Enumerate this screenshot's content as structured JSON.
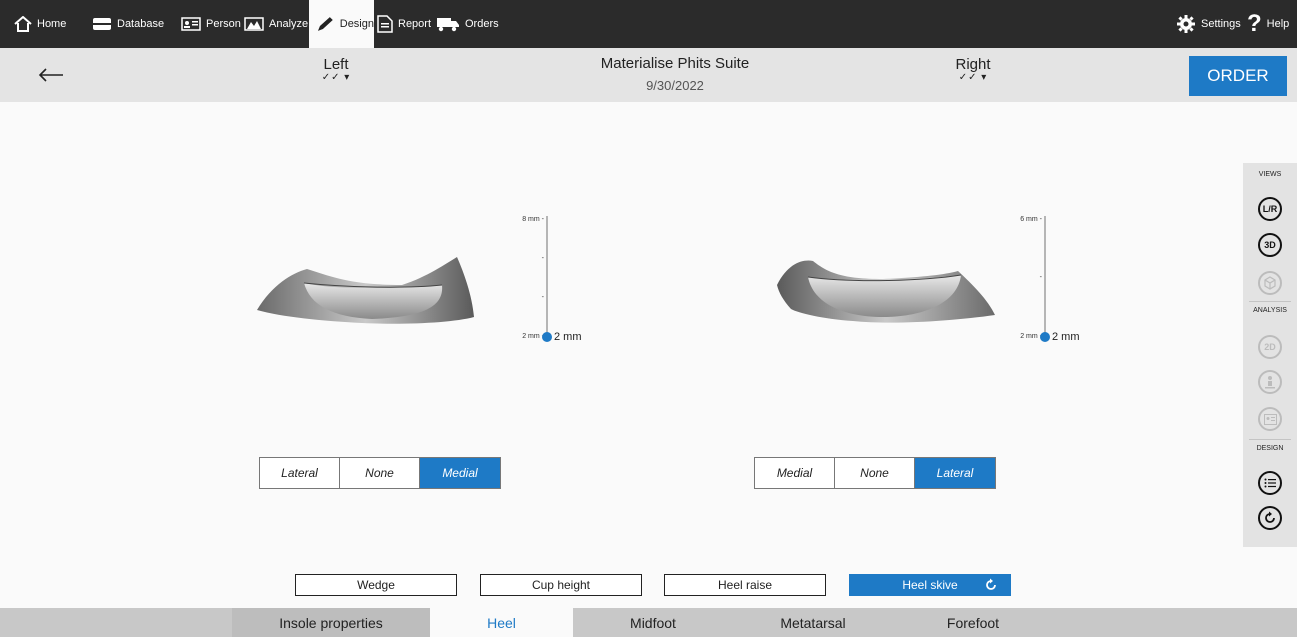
{
  "nav": {
    "items": [
      {
        "label": "Home",
        "icon": "home-icon"
      },
      {
        "label": "Database",
        "icon": "database-icon"
      },
      {
        "label": "Person",
        "icon": "person-card-icon"
      },
      {
        "label": "Analyze",
        "icon": "analyze-icon"
      },
      {
        "label": "Design",
        "icon": "pencil-icon",
        "active": true
      },
      {
        "label": "Report",
        "icon": "report-icon"
      },
      {
        "label": "Orders",
        "icon": "truck-icon"
      }
    ],
    "settings_label": "Settings",
    "help_label": "Help"
  },
  "header": {
    "left_label": "Left",
    "right_label": "Right",
    "check_mark": "✓✓ ▾",
    "title": "Materialise Phits Suite",
    "date": "9/30/2022",
    "order_label": "ORDER"
  },
  "left_panel": {
    "slider": {
      "ticks": [
        "8 mm -",
        "-",
        "-",
        "2 mm -"
      ],
      "value_label": "2 mm",
      "value_mm": 2,
      "min_mm": 2,
      "max_mm": 8
    },
    "options": [
      "Lateral",
      "None",
      "Medial"
    ],
    "selected": "Medial"
  },
  "right_panel": {
    "slider": {
      "ticks": [
        "6 mm -",
        "-",
        "2 mm -"
      ],
      "value_label": "2 mm",
      "value_mm": 2,
      "min_mm": 2,
      "max_mm": 6
    },
    "options": [
      "Medial",
      "None",
      "Lateral"
    ],
    "selected": "Lateral"
  },
  "side_panel": {
    "views_label": "VIEWS",
    "analysis_label": "ANALYSIS",
    "design_label": "DESIGN",
    "lr_label": "L/R",
    "three_d_label": "3D",
    "two_d_label": "2D"
  },
  "heel_buttons": {
    "wedge": "Wedge",
    "cup_height": "Cup height",
    "heel_raise": "Heel raise",
    "heel_skive": "Heel skive"
  },
  "tabs": [
    "Insole properties",
    "Heel",
    "Midfoot",
    "Metatarsal",
    "Forefoot"
  ],
  "active_tab": "Heel",
  "colors": {
    "accent": "#1e7ac6",
    "nav_bg": "#2b2b2b",
    "header_bg": "#e4e4e4",
    "tab_bg": "#c8c8c8"
  }
}
